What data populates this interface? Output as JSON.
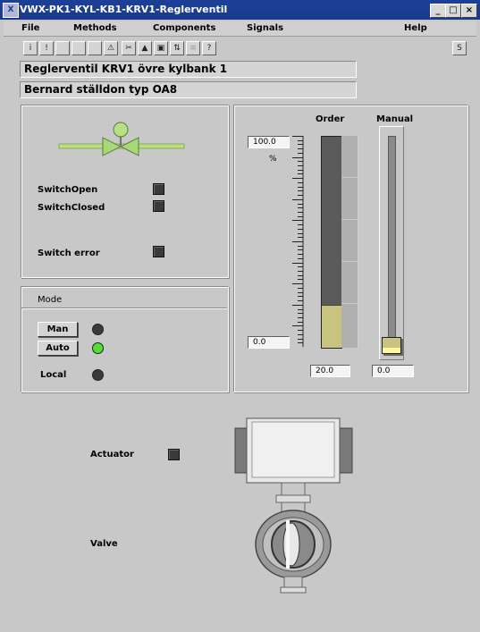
{
  "window": {
    "title": "VWX-PK1-KYL-KB1-KRV1-Reglerventil",
    "app_icon": "X",
    "controls": [
      "minimize-button",
      "maximize-button",
      "close-button"
    ]
  },
  "menu": {
    "items": [
      "File",
      "Methods",
      "Components",
      "Signals",
      "Help"
    ]
  },
  "toolbar": {
    "icons": [
      "info",
      "alarm",
      "disabled1",
      "disabled2",
      "disabled3",
      "warning",
      "tools",
      "pointer",
      "window",
      "swap",
      "list",
      "help"
    ],
    "glyphs": [
      "i",
      "!",
      "",
      "",
      "",
      "⚠",
      "✂",
      "▲",
      "▣",
      "⇅",
      "≡",
      "?"
    ],
    "right_glyph": "S"
  },
  "header": {
    "description": "Reglerventil KRV1 övre kylbank 1",
    "actuator_type": "Bernard ställdon typ OA8"
  },
  "status": {
    "switch_open_label": "SwitchOpen",
    "switch_closed_label": "SwitchClosed",
    "switch_error_label": "Switch error"
  },
  "mode": {
    "title": "Mode",
    "man_label": "Man",
    "auto_label": "Auto",
    "local_label": "Local",
    "auto_active": true
  },
  "order": {
    "title": "Order",
    "max_label": "100.0",
    "min_label": "0.0",
    "unit": "%",
    "value_text": "20.0",
    "value": 20
  },
  "manual": {
    "title": "Manual",
    "value_text": "0.0",
    "value": 0
  },
  "schematic": {
    "actuator_label": "Actuator",
    "valve_label": "Valve"
  },
  "colors": {
    "titlebar": "#1c3f98",
    "background": "#c8c8c8",
    "led_on": "#50e030",
    "led_off": "#3a3a3a",
    "bar_fill": "#c8c480",
    "valve_green": "#a8d878"
  }
}
